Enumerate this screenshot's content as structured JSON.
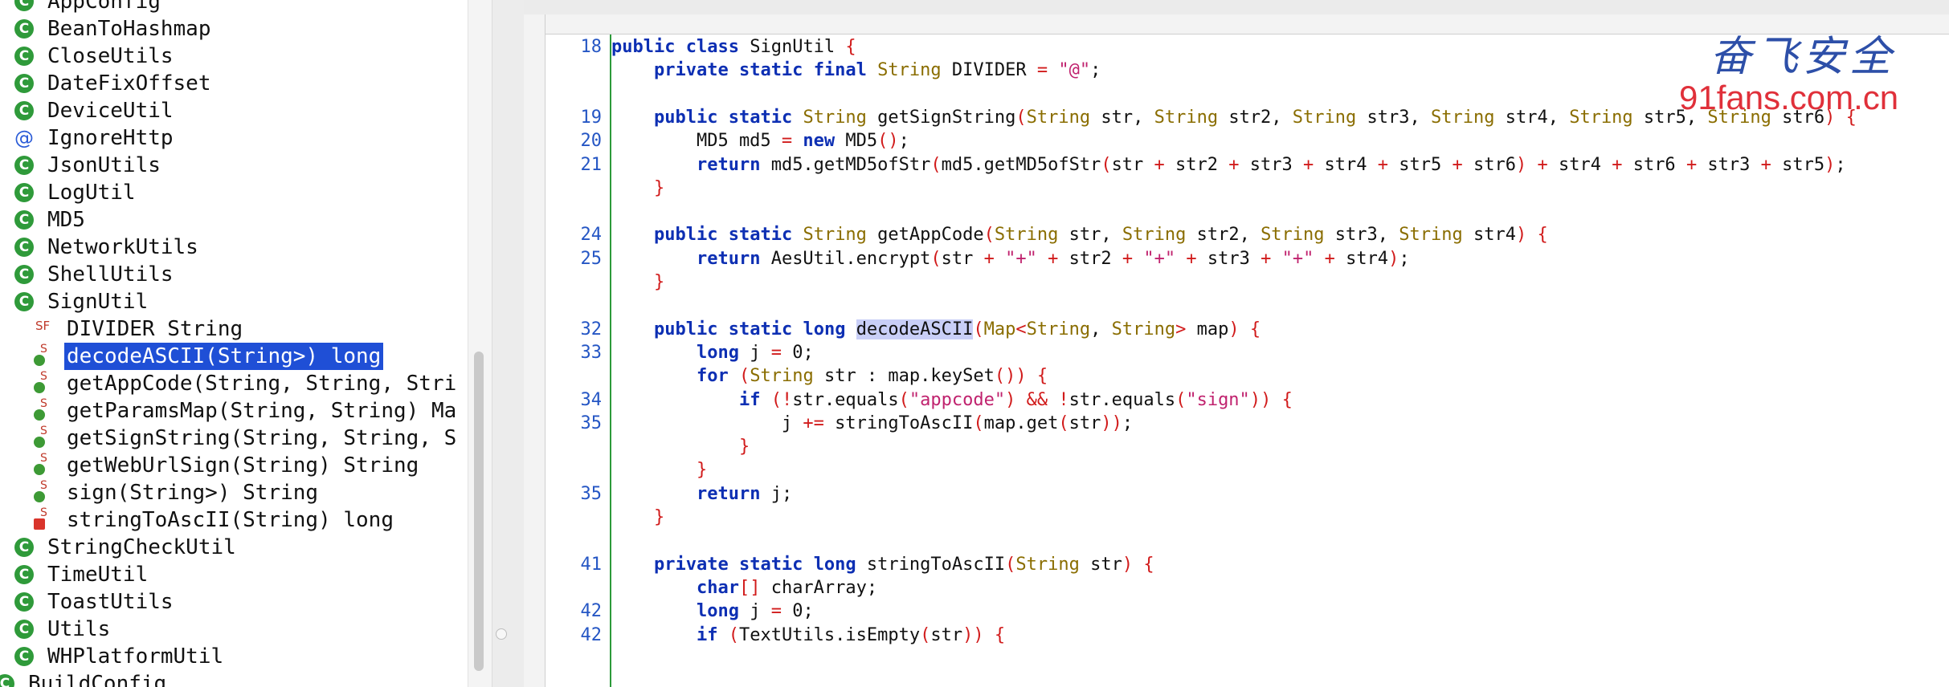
{
  "tree": {
    "items": [
      {
        "label": "AppConfig",
        "icon": "class-icon"
      },
      {
        "label": "BeanToHashmap",
        "icon": "class-icon"
      },
      {
        "label": "CloseUtils",
        "icon": "class-icon"
      },
      {
        "label": "DateFixOffset",
        "icon": "class-icon"
      },
      {
        "label": "DeviceUtil",
        "icon": "class-icon"
      },
      {
        "label": "IgnoreHttp",
        "icon": "annotation-icon"
      },
      {
        "label": "JsonUtils",
        "icon": "class-icon"
      },
      {
        "label": "LogUtil",
        "icon": "class-icon"
      },
      {
        "label": "MD5",
        "icon": "class-icon"
      },
      {
        "label": "NetworkUtils",
        "icon": "class-icon"
      },
      {
        "label": "ShellUtils",
        "icon": "class-icon"
      },
      {
        "label": "SignUtil",
        "icon": "class-icon"
      },
      {
        "label": "DIVIDER String",
        "icon": "static-final-field-icon"
      },
      {
        "label": "decodeASCII(String>) long",
        "icon": "public-static-method-icon",
        "selected": true
      },
      {
        "label": "getAppCode(String, String, Stri",
        "icon": "public-static-method-icon"
      },
      {
        "label": "getParamsMap(String, String) Ma",
        "icon": "public-static-method-icon"
      },
      {
        "label": "getSignString(String, String, S",
        "icon": "public-static-method-icon"
      },
      {
        "label": "getWebUrlSign(String) String",
        "icon": "public-static-method-icon"
      },
      {
        "label": "sign(String>) String",
        "icon": "public-static-method-icon"
      },
      {
        "label": "stringToAscII(String) long",
        "icon": "private-static-method-icon"
      },
      {
        "label": "StringCheckUtil",
        "icon": "class-icon"
      },
      {
        "label": "TimeUtil",
        "icon": "class-icon"
      },
      {
        "label": "ToastUtils",
        "icon": "class-icon"
      },
      {
        "label": "Utils",
        "icon": "class-icon"
      },
      {
        "label": "WHPlatformUtil",
        "icon": "class-icon"
      },
      {
        "label": "BuildConfig",
        "icon": "class-icon"
      }
    ],
    "class_icon_glyph": "C",
    "annotation_icon_glyph": "@",
    "static_final_glyph": "SF",
    "static_glyph": "S"
  },
  "editor": {
    "lines": [
      {
        "n": "18",
        "t": "public class SignUtil {"
      },
      {
        "n": "",
        "t": "    private static final String DIVIDER = \"@\";"
      },
      {
        "n": "",
        "t": ""
      },
      {
        "n": "19",
        "t": "    public static String getSignString(String str, String str2, String str3, String str4, String str5, String str6) {"
      },
      {
        "n": "20",
        "t": "        MD5 md5 = new MD5();"
      },
      {
        "n": "21",
        "t": "        return md5.getMD5ofStr(md5.getMD5ofStr(str + str2 + str3 + str4 + str5 + str6) + str4 + str6 + str3 + str5);"
      },
      {
        "n": "",
        "t": "    }"
      },
      {
        "n": "",
        "t": ""
      },
      {
        "n": "24",
        "t": "    public static String getAppCode(String str, String str2, String str3, String str4) {"
      },
      {
        "n": "25",
        "t": "        return AesUtil.encrypt(str + \"+\" + str2 + \"+\" + str3 + \"+\" + str4);"
      },
      {
        "n": "",
        "t": "    }"
      },
      {
        "n": "",
        "t": ""
      },
      {
        "n": "32",
        "t": "    public static long decodeASCII(Map<String, String> map) {"
      },
      {
        "n": "33",
        "t": "        long j = 0;"
      },
      {
        "n": "",
        "t": "        for (String str : map.keySet()) {"
      },
      {
        "n": "34",
        "t": "            if (!str.equals(\"appcode\") && !str.equals(\"sign\")) {"
      },
      {
        "n": "35",
        "t": "                j += stringToAscII(map.get(str));"
      },
      {
        "n": "",
        "t": "            }"
      },
      {
        "n": "",
        "t": "        }"
      },
      {
        "n": "35",
        "t": "        return j;"
      },
      {
        "n": "",
        "t": "    }"
      },
      {
        "n": "",
        "t": ""
      },
      {
        "n": "41",
        "t": "    private static long stringToAscII(String str) {"
      },
      {
        "n": "",
        "t": "        char[] charArray;"
      },
      {
        "n": "42",
        "t": "        long j = 0;"
      },
      {
        "n": "42",
        "t": "        if (TextUtils.isEmpty(str)) {"
      }
    ],
    "highlight_word": "decodeASCII"
  },
  "watermark": {
    "cn": "奋飞安全",
    "url": "91fans.com.cn"
  },
  "colors": {
    "keyword": "#0d2fb3",
    "type": "#8a6d00",
    "string": "#c0226e",
    "punct": "#d11b1b",
    "line_number": "#2556c4",
    "selection": "#1f4fd6",
    "class_icon": "#2f9a3a"
  }
}
